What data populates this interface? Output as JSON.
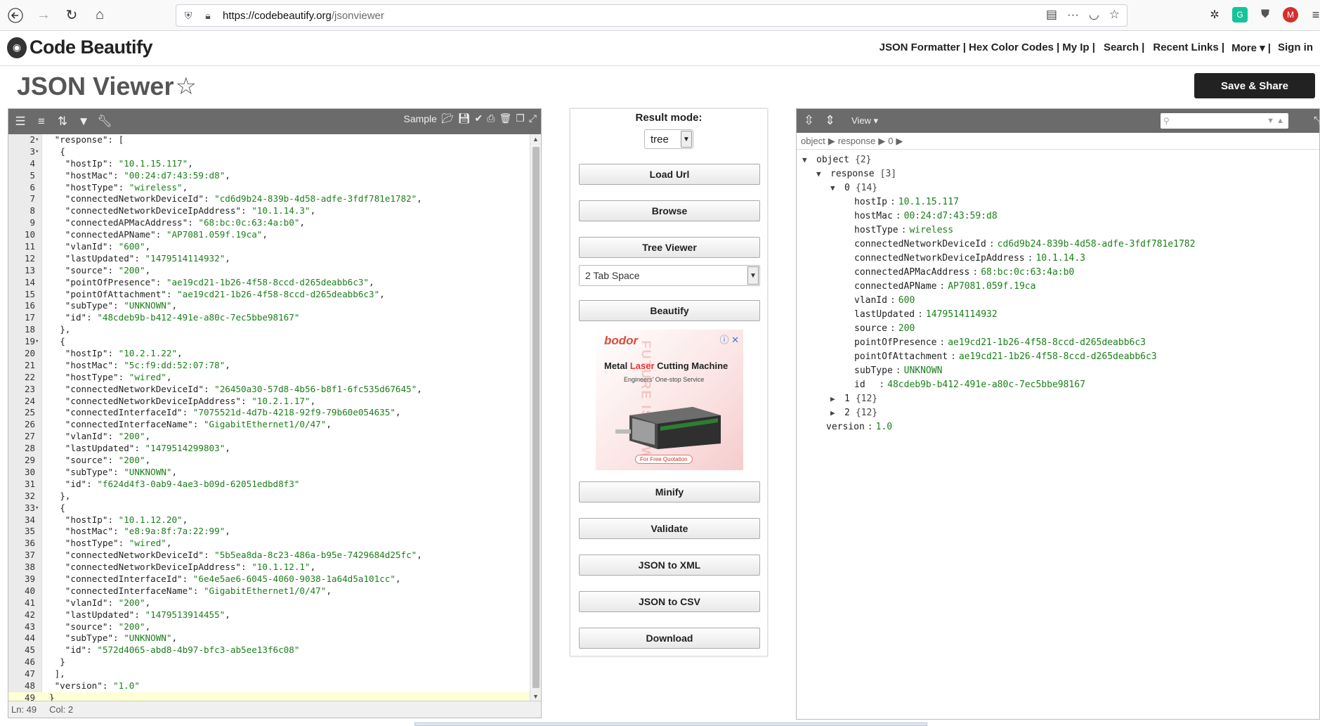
{
  "browser": {
    "url_host": "https://codebeautify.org",
    "url_path": "/jsonviewer"
  },
  "site": {
    "logo_text": "Code Beautify",
    "nav": [
      "JSON Formatter |",
      "Hex Color Codes |",
      "My Ip |",
      "Search |",
      "Recent Links |",
      "More ▾ |",
      "Sign in"
    ]
  },
  "page": {
    "title": "JSON Viewer",
    "save_share": "Save & Share"
  },
  "editor": {
    "sample_label": "Sample",
    "status_ln": "Ln: 49",
    "status_col": "Col: 2",
    "lines": [
      {
        "n": "2",
        "fold": "▾",
        "indent": 2,
        "parts": [
          [
            "k",
            "\"response\""
          ],
          [
            "p",
            ": ["
          ]
        ]
      },
      {
        "n": "3",
        "fold": "▾",
        "indent": 4,
        "parts": [
          [
            "p",
            "{"
          ]
        ]
      },
      {
        "n": "4",
        "indent": 6,
        "parts": [
          [
            "k",
            "\"hostIp\""
          ],
          [
            "p",
            ": "
          ],
          [
            "s",
            "\"10.1.15.117\""
          ],
          [
            "p",
            ","
          ]
        ]
      },
      {
        "n": "5",
        "indent": 6,
        "parts": [
          [
            "k",
            "\"hostMac\""
          ],
          [
            "p",
            ": "
          ],
          [
            "s",
            "\"00:24:d7:43:59:d8\""
          ],
          [
            "p",
            ","
          ]
        ]
      },
      {
        "n": "6",
        "indent": 6,
        "parts": [
          [
            "k",
            "\"hostType\""
          ],
          [
            "p",
            ": "
          ],
          [
            "s",
            "\"wireless\""
          ],
          [
            "p",
            ","
          ]
        ]
      },
      {
        "n": "7",
        "indent": 6,
        "parts": [
          [
            "k",
            "\"connectedNetworkDeviceId\""
          ],
          [
            "p",
            ": "
          ],
          [
            "s",
            "\"cd6d9b24-839b-4d58-adfe-3fdf781e1782\""
          ],
          [
            "p",
            ","
          ]
        ]
      },
      {
        "n": "8",
        "indent": 6,
        "parts": [
          [
            "k",
            "\"connectedNetworkDeviceIpAddress\""
          ],
          [
            "p",
            ": "
          ],
          [
            "s",
            "\"10.1.14.3\""
          ],
          [
            "p",
            ","
          ]
        ]
      },
      {
        "n": "9",
        "indent": 6,
        "parts": [
          [
            "k",
            "\"connectedAPMacAddress\""
          ],
          [
            "p",
            ": "
          ],
          [
            "s",
            "\"68:bc:0c:63:4a:b0\""
          ],
          [
            "p",
            ","
          ]
        ]
      },
      {
        "n": "10",
        "indent": 6,
        "parts": [
          [
            "k",
            "\"connectedAPName\""
          ],
          [
            "p",
            ": "
          ],
          [
            "s",
            "\"AP7081.059f.19ca\""
          ],
          [
            "p",
            ","
          ]
        ]
      },
      {
        "n": "11",
        "indent": 6,
        "parts": [
          [
            "k",
            "\"vlanId\""
          ],
          [
            "p",
            ": "
          ],
          [
            "s",
            "\"600\""
          ],
          [
            "p",
            ","
          ]
        ]
      },
      {
        "n": "12",
        "indent": 6,
        "parts": [
          [
            "k",
            "\"lastUpdated\""
          ],
          [
            "p",
            ": "
          ],
          [
            "s",
            "\"1479514114932\""
          ],
          [
            "p",
            ","
          ]
        ]
      },
      {
        "n": "13",
        "indent": 6,
        "parts": [
          [
            "k",
            "\"source\""
          ],
          [
            "p",
            ": "
          ],
          [
            "s",
            "\"200\""
          ],
          [
            "p",
            ","
          ]
        ]
      },
      {
        "n": "14",
        "indent": 6,
        "parts": [
          [
            "k",
            "\"pointOfPresence\""
          ],
          [
            "p",
            ": "
          ],
          [
            "s",
            "\"ae19cd21-1b26-4f58-8ccd-d265deabb6c3\""
          ],
          [
            "p",
            ","
          ]
        ]
      },
      {
        "n": "15",
        "indent": 6,
        "parts": [
          [
            "k",
            "\"pointOfAttachment\""
          ],
          [
            "p",
            ": "
          ],
          [
            "s",
            "\"ae19cd21-1b26-4f58-8ccd-d265deabb6c3\""
          ],
          [
            "p",
            ","
          ]
        ]
      },
      {
        "n": "16",
        "indent": 6,
        "parts": [
          [
            "k",
            "\"subType\""
          ],
          [
            "p",
            ": "
          ],
          [
            "s",
            "\"UNKNOWN\""
          ],
          [
            "p",
            ","
          ]
        ]
      },
      {
        "n": "17",
        "indent": 6,
        "parts": [
          [
            "k",
            "\"id\""
          ],
          [
            "p",
            ": "
          ],
          [
            "s",
            "\"48cdeb9b-b412-491e-a80c-7ec5bbe98167\""
          ]
        ]
      },
      {
        "n": "18",
        "indent": 4,
        "parts": [
          [
            "p",
            "},"
          ]
        ]
      },
      {
        "n": "19",
        "fold": "▾",
        "indent": 4,
        "parts": [
          [
            "p",
            "{"
          ]
        ]
      },
      {
        "n": "20",
        "indent": 6,
        "parts": [
          [
            "k",
            "\"hostIp\""
          ],
          [
            "p",
            ": "
          ],
          [
            "s",
            "\"10.2.1.22\""
          ],
          [
            "p",
            ","
          ]
        ]
      },
      {
        "n": "21",
        "indent": 6,
        "parts": [
          [
            "k",
            "\"hostMac\""
          ],
          [
            "p",
            ": "
          ],
          [
            "s",
            "\"5c:f9:dd:52:07:78\""
          ],
          [
            "p",
            ","
          ]
        ]
      },
      {
        "n": "22",
        "indent": 6,
        "parts": [
          [
            "k",
            "\"hostType\""
          ],
          [
            "p",
            ": "
          ],
          [
            "s",
            "\"wired\""
          ],
          [
            "p",
            ","
          ]
        ]
      },
      {
        "n": "23",
        "indent": 6,
        "parts": [
          [
            "k",
            "\"connectedNetworkDeviceId\""
          ],
          [
            "p",
            ": "
          ],
          [
            "s",
            "\"26450a30-57d8-4b56-b8f1-6fc535d67645\""
          ],
          [
            "p",
            ","
          ]
        ]
      },
      {
        "n": "24",
        "indent": 6,
        "parts": [
          [
            "k",
            "\"connectedNetworkDeviceIpAddress\""
          ],
          [
            "p",
            ": "
          ],
          [
            "s",
            "\"10.2.1.17\""
          ],
          [
            "p",
            ","
          ]
        ]
      },
      {
        "n": "25",
        "indent": 6,
        "parts": [
          [
            "k",
            "\"connectedInterfaceId\""
          ],
          [
            "p",
            ": "
          ],
          [
            "s",
            "\"7075521d-4d7b-4218-92f9-79b60e054635\""
          ],
          [
            "p",
            ","
          ]
        ]
      },
      {
        "n": "26",
        "indent": 6,
        "parts": [
          [
            "k",
            "\"connectedInterfaceName\""
          ],
          [
            "p",
            ": "
          ],
          [
            "s",
            "\"GigabitEthernet1/0/47\""
          ],
          [
            "p",
            ","
          ]
        ]
      },
      {
        "n": "27",
        "indent": 6,
        "parts": [
          [
            "k",
            "\"vlanId\""
          ],
          [
            "p",
            ": "
          ],
          [
            "s",
            "\"200\""
          ],
          [
            "p",
            ","
          ]
        ]
      },
      {
        "n": "28",
        "indent": 6,
        "parts": [
          [
            "k",
            "\"lastUpdated\""
          ],
          [
            "p",
            ": "
          ],
          [
            "s",
            "\"1479514299803\""
          ],
          [
            "p",
            ","
          ]
        ]
      },
      {
        "n": "29",
        "indent": 6,
        "parts": [
          [
            "k",
            "\"source\""
          ],
          [
            "p",
            ": "
          ],
          [
            "s",
            "\"200\""
          ],
          [
            "p",
            ","
          ]
        ]
      },
      {
        "n": "30",
        "indent": 6,
        "parts": [
          [
            "k",
            "\"subType\""
          ],
          [
            "p",
            ": "
          ],
          [
            "s",
            "\"UNKNOWN\""
          ],
          [
            "p",
            ","
          ]
        ]
      },
      {
        "n": "31",
        "indent": 6,
        "parts": [
          [
            "k",
            "\"id\""
          ],
          [
            "p",
            ": "
          ],
          [
            "s",
            "\"f624d4f3-0ab9-4ae3-b09d-62051edbd8f3\""
          ]
        ]
      },
      {
        "n": "32",
        "indent": 4,
        "parts": [
          [
            "p",
            "},"
          ]
        ]
      },
      {
        "n": "33",
        "fold": "▾",
        "indent": 4,
        "parts": [
          [
            "p",
            "{"
          ]
        ]
      },
      {
        "n": "34",
        "indent": 6,
        "parts": [
          [
            "k",
            "\"hostIp\""
          ],
          [
            "p",
            ": "
          ],
          [
            "s",
            "\"10.1.12.20\""
          ],
          [
            "p",
            ","
          ]
        ]
      },
      {
        "n": "35",
        "indent": 6,
        "parts": [
          [
            "k",
            "\"hostMac\""
          ],
          [
            "p",
            ": "
          ],
          [
            "s",
            "\"e8:9a:8f:7a:22:99\""
          ],
          [
            "p",
            ","
          ]
        ]
      },
      {
        "n": "36",
        "indent": 6,
        "parts": [
          [
            "k",
            "\"hostType\""
          ],
          [
            "p",
            ": "
          ],
          [
            "s",
            "\"wired\""
          ],
          [
            "p",
            ","
          ]
        ]
      },
      {
        "n": "37",
        "indent": 6,
        "parts": [
          [
            "k",
            "\"connectedNetworkDeviceId\""
          ],
          [
            "p",
            ": "
          ],
          [
            "s",
            "\"5b5ea8da-8c23-486a-b95e-7429684d25fc\""
          ],
          [
            "p",
            ","
          ]
        ]
      },
      {
        "n": "38",
        "indent": 6,
        "parts": [
          [
            "k",
            "\"connectedNetworkDeviceIpAddress\""
          ],
          [
            "p",
            ": "
          ],
          [
            "s",
            "\"10.1.12.1\""
          ],
          [
            "p",
            ","
          ]
        ]
      },
      {
        "n": "39",
        "indent": 6,
        "parts": [
          [
            "k",
            "\"connectedInterfaceId\""
          ],
          [
            "p",
            ": "
          ],
          [
            "s",
            "\"6e4e5ae6-6045-4060-9038-1a64d5a101cc\""
          ],
          [
            "p",
            ","
          ]
        ]
      },
      {
        "n": "40",
        "indent": 6,
        "parts": [
          [
            "k",
            "\"connectedInterfaceName\""
          ],
          [
            "p",
            ": "
          ],
          [
            "s",
            "\"GigabitEthernet1/0/47\""
          ],
          [
            "p",
            ","
          ]
        ]
      },
      {
        "n": "41",
        "indent": 6,
        "parts": [
          [
            "k",
            "\"vlanId\""
          ],
          [
            "p",
            ": "
          ],
          [
            "s",
            "\"200\""
          ],
          [
            "p",
            ","
          ]
        ]
      },
      {
        "n": "42",
        "indent": 6,
        "parts": [
          [
            "k",
            "\"lastUpdated\""
          ],
          [
            "p",
            ": "
          ],
          [
            "s",
            "\"1479513914455\""
          ],
          [
            "p",
            ","
          ]
        ]
      },
      {
        "n": "43",
        "indent": 6,
        "parts": [
          [
            "k",
            "\"source\""
          ],
          [
            "p",
            ": "
          ],
          [
            "s",
            "\"200\""
          ],
          [
            "p",
            ","
          ]
        ]
      },
      {
        "n": "44",
        "indent": 6,
        "parts": [
          [
            "k",
            "\"subType\""
          ],
          [
            "p",
            ": "
          ],
          [
            "s",
            "\"UNKNOWN\""
          ],
          [
            "p",
            ","
          ]
        ]
      },
      {
        "n": "45",
        "indent": 6,
        "parts": [
          [
            "k",
            "\"id\""
          ],
          [
            "p",
            ": "
          ],
          [
            "s",
            "\"572d4065-abd8-4b97-bfc3-ab5ee13f6c08\""
          ]
        ]
      },
      {
        "n": "46",
        "indent": 4,
        "parts": [
          [
            "p",
            "}"
          ]
        ]
      },
      {
        "n": "47",
        "indent": 2,
        "parts": [
          [
            "p",
            "],"
          ]
        ]
      },
      {
        "n": "48",
        "indent": 2,
        "parts": [
          [
            "k",
            "\"version\""
          ],
          [
            "p",
            ": "
          ],
          [
            "s",
            "\"1.0\""
          ]
        ]
      },
      {
        "n": "49",
        "indent": 0,
        "active": true,
        "parts": [
          [
            "p",
            "}"
          ]
        ]
      }
    ]
  },
  "middle": {
    "result_mode_label": "Result mode:",
    "result_mode_value": "tree",
    "tab_space_value": "2 Tab Space",
    "buttons": {
      "load_url": "Load Url",
      "browse": "Browse",
      "tree_viewer": "Tree Viewer",
      "beautify": "Beautify",
      "minify": "Minify",
      "validate": "Validate",
      "json_to_xml": "JSON to XML",
      "json_to_csv": "JSON to CSV",
      "download": "Download"
    },
    "ad": {
      "brand": "bodor",
      "title_a": "Metal ",
      "title_b": "Laser",
      "title_c": " Cutting Machine",
      "subtitle": "Engineers' One-stop Service",
      "cta": "For Free Quotation",
      "side_text": "FUTURE IS NOW"
    }
  },
  "tree": {
    "view_label": "View ▾",
    "breadcrumb": [
      "object",
      "response",
      "0"
    ],
    "nodes": [
      {
        "depth": 0,
        "tri": "▼",
        "key": "object",
        "count": "{2}"
      },
      {
        "depth": 1,
        "tri": "▼",
        "key": "response",
        "count": "[3]"
      },
      {
        "depth": 2,
        "tri": "▼",
        "key": "0",
        "count": "{14}"
      },
      {
        "depth": 3,
        "key": "hostIp",
        "value": "10.1.15.117"
      },
      {
        "depth": 3,
        "key": "hostMac",
        "value": "00:24:d7:43:59:d8"
      },
      {
        "depth": 3,
        "key": "hostType",
        "value": "wireless"
      },
      {
        "depth": 3,
        "key": "connectedNetworkDeviceId",
        "value": "cd6d9b24-839b-4d58-adfe-3fdf781e1782"
      },
      {
        "depth": 3,
        "key": "connectedNetworkDeviceIpAddress",
        "value": "10.1.14.3"
      },
      {
        "depth": 3,
        "key": "connectedAPMacAddress",
        "value": "68:bc:0c:63:4a:b0"
      },
      {
        "depth": 3,
        "key": "connectedAPName",
        "value": "AP7081.059f.19ca"
      },
      {
        "depth": 3,
        "key": "vlanId",
        "value": "600"
      },
      {
        "depth": 3,
        "key": "lastUpdated",
        "value": "1479514114932"
      },
      {
        "depth": 3,
        "key": "source",
        "value": "200"
      },
      {
        "depth": 3,
        "key": "pointOfPresence",
        "value": "ae19cd21-1b26-4f58-8ccd-d265deabb6c3"
      },
      {
        "depth": 3,
        "key": "pointOfAttachment",
        "value": "ae19cd21-1b26-4f58-8ccd-d265deabb6c3"
      },
      {
        "depth": 3,
        "key": "subType",
        "value": "UNKNOWN"
      },
      {
        "depth": 3,
        "key": "id  ",
        "value": "48cdeb9b-b412-491e-a80c-7ec5bbe98167"
      },
      {
        "depth": 2,
        "tri": "▶",
        "key": "1",
        "count": "{12}"
      },
      {
        "depth": 2,
        "tri": "▶",
        "key": "2",
        "count": "{12}"
      },
      {
        "depth": 1,
        "key": "version",
        "value": "1.0"
      }
    ]
  }
}
